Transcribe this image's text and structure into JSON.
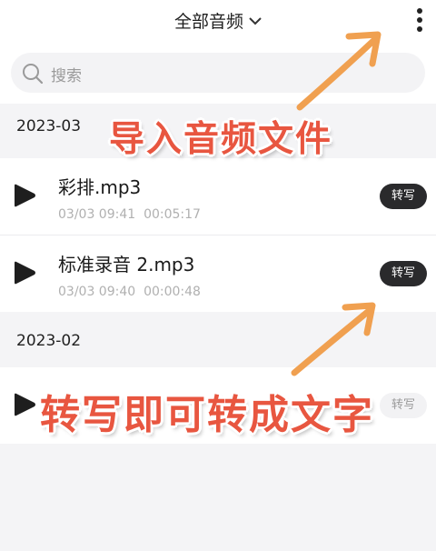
{
  "header": {
    "title": "全部音频",
    "dropdown_icon": "chevron-down-icon",
    "more_icon": "more-vertical-icon"
  },
  "search": {
    "placeholder": "搜索",
    "icon": "search-icon"
  },
  "sections": [
    {
      "label": "2023-03",
      "items": [
        {
          "name": "彩排.mp3",
          "date": "03/03 09:41",
          "duration": "00:05:17",
          "action": "转写"
        },
        {
          "name": "标准录音 2.mp3",
          "date": "03/03 09:40",
          "duration": "00:00:48",
          "action": "转写"
        }
      ]
    },
    {
      "label": "2023-02",
      "items": [
        {
          "name": "",
          "date": "",
          "duration": "",
          "action": "转写"
        }
      ]
    }
  ],
  "annotations": {
    "import_caption": "导入音频文件",
    "transcribe_caption": "转写即可转成文字"
  },
  "colors": {
    "annotation": "#e85640",
    "arrow": "#f0a050",
    "button_dark": "#2a2a2c",
    "background": "#f4f4f6"
  }
}
